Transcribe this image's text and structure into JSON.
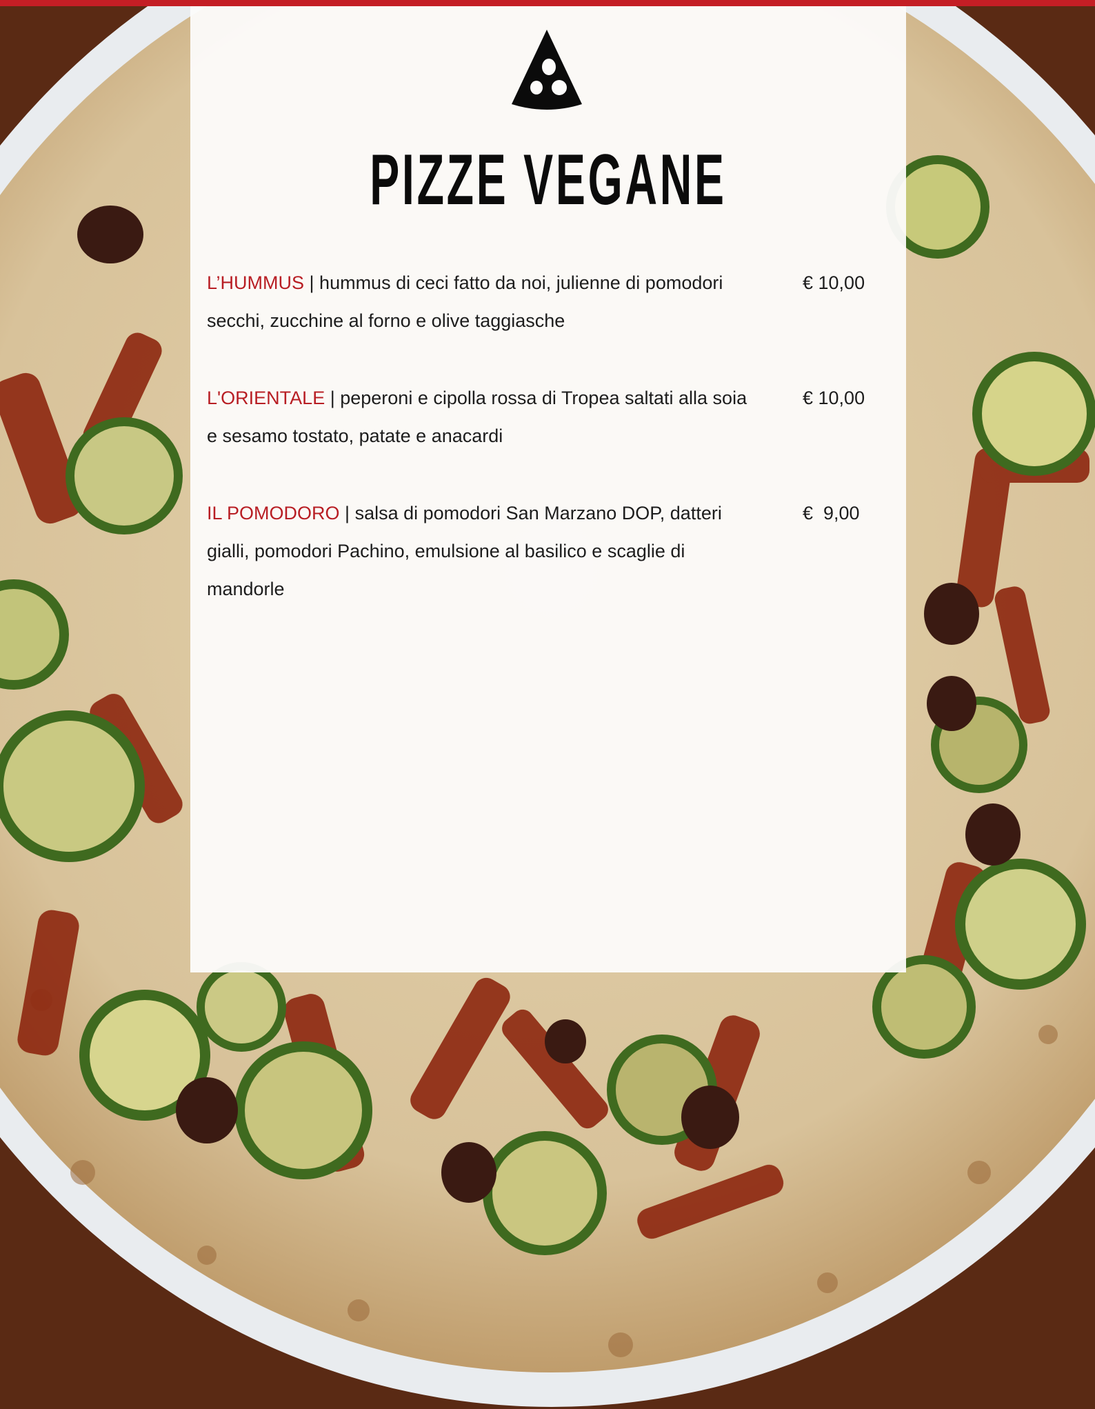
{
  "colors": {
    "accent_red": "#c41e25",
    "item_name_red": "#b81e24",
    "text": "#1d1d1d",
    "card": "#fcfbfa"
  },
  "logo_icon": "pizza-slice-icon",
  "title": "PIZZE VEGANE",
  "separator": " | ",
  "items": [
    {
      "name": "L’HUMMUS",
      "description": "hummus di ceci fatto da noi, julienne di pomodori secchi, zucchine al forno e olive taggiasche",
      "price": "€ 10,00"
    },
    {
      "name": "L'ORIENTALE",
      "description": "peperoni e cipolla rossa di Tropea saltati alla soia e sesamo tostato, patate e anacardi",
      "price": "€ 10,00"
    },
    {
      "name": "IL POMODORO",
      "description": "salsa di pomodori San Marzano DOP, datteri gialli, pomodori Pachino, emulsione al basilico e scaglie di mandorle",
      "price": "€  9,00"
    }
  ]
}
